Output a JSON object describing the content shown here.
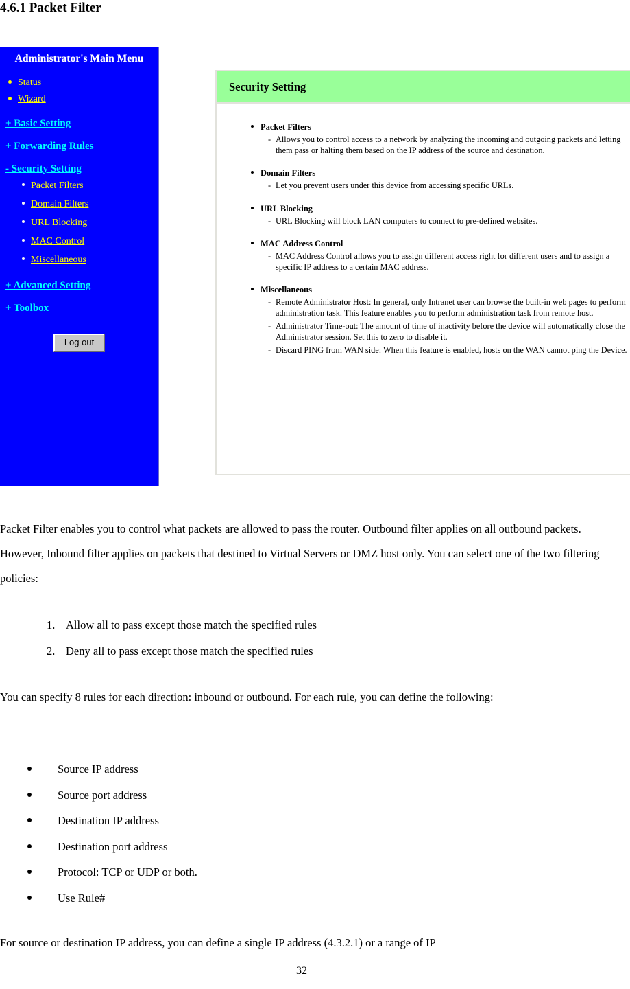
{
  "document": {
    "heading": "4.6.1 Packet Filter",
    "page_number": "32"
  },
  "figure": {
    "sidebar": {
      "title": "Administrator's Main Menu",
      "colors": {
        "background": "#0000ff",
        "link": "#ffff00",
        "section_link": "#00ffff",
        "title": "#ffffff"
      },
      "simple_items": [
        {
          "label": "Status"
        },
        {
          "label": "Wizard"
        }
      ],
      "sections": [
        {
          "label": "+ Basic Setting",
          "expanded": false,
          "children": []
        },
        {
          "label": "+ Forwarding Rules",
          "expanded": false,
          "children": []
        },
        {
          "label": "- Security Setting",
          "expanded": true,
          "children": [
            {
              "label": "Packet Filters"
            },
            {
              "label": "Domain Filters"
            },
            {
              "label": "URL Blocking"
            },
            {
              "label": "MAC Control"
            },
            {
              "label": "Miscellaneous"
            }
          ]
        },
        {
          "label": "+ Advanced Setting",
          "expanded": false,
          "children": []
        },
        {
          "label": "+ Toolbox",
          "expanded": false,
          "children": []
        }
      ],
      "logout_label": "Log out"
    },
    "panel": {
      "header": "Security Setting",
      "header_color": "#99ff99",
      "features": [
        {
          "title": "Packet Filters",
          "descriptions": [
            "Allows you to control access to a network by analyzing the incoming and outgoing packets and letting them pass or halting them based on the IP address of the source and destination."
          ]
        },
        {
          "title": "Domain Filters",
          "descriptions": [
            "Let you prevent users under this device from accessing specific URLs."
          ]
        },
        {
          "title": "URL Blocking",
          "descriptions": [
            "URL Blocking will block LAN computers to connect to pre-defined websites."
          ]
        },
        {
          "title": "MAC Address Control",
          "descriptions": [
            "MAC Address Control allows you to assign different access right for different users and to assign a specific IP address to a certain MAC address."
          ]
        },
        {
          "title": "Miscellaneous",
          "descriptions": [
            "Remote Administrator Host: In general, only Intranet user can browse the built-in web pages to perform administration task. This feature enables you to perform administration task from remote host.",
            "Administrator Time-out: The amount of time of inactivity before the device will automatically close the Administrator session. Set this to zero to disable it.",
            "Discard PING from WAN side: When this feature is enabled, hosts on the WAN cannot ping the Device."
          ]
        }
      ]
    }
  },
  "body": {
    "intro": "Packet Filter enables you to control what packets are allowed to pass the router. Outbound filter applies on all outbound packets. However, Inbound filter applies on packets that destined to Virtual Servers or DMZ host only. You can select one of the two filtering policies:",
    "policies": [
      {
        "number": "1.",
        "text": "Allow all to pass except those match the specified rules"
      },
      {
        "number": "2.",
        "text": "Deny all to pass except those match the specified rules"
      }
    ],
    "spec": "You can specify 8 rules for each direction: inbound or outbound. For each rule, you can define the following:",
    "rule_fields": [
      {
        "label": "Source IP address"
      },
      {
        "label": "Source port address"
      },
      {
        "label": "Destination IP address"
      },
      {
        "label": "Destination port address"
      },
      {
        "label": "Protocol: TCP or UDP or both."
      },
      {
        "label": "Use Rule#"
      }
    ],
    "closing": "For source or destination IP address, you can define a single IP address (4.3.2.1) or a range of IP"
  }
}
